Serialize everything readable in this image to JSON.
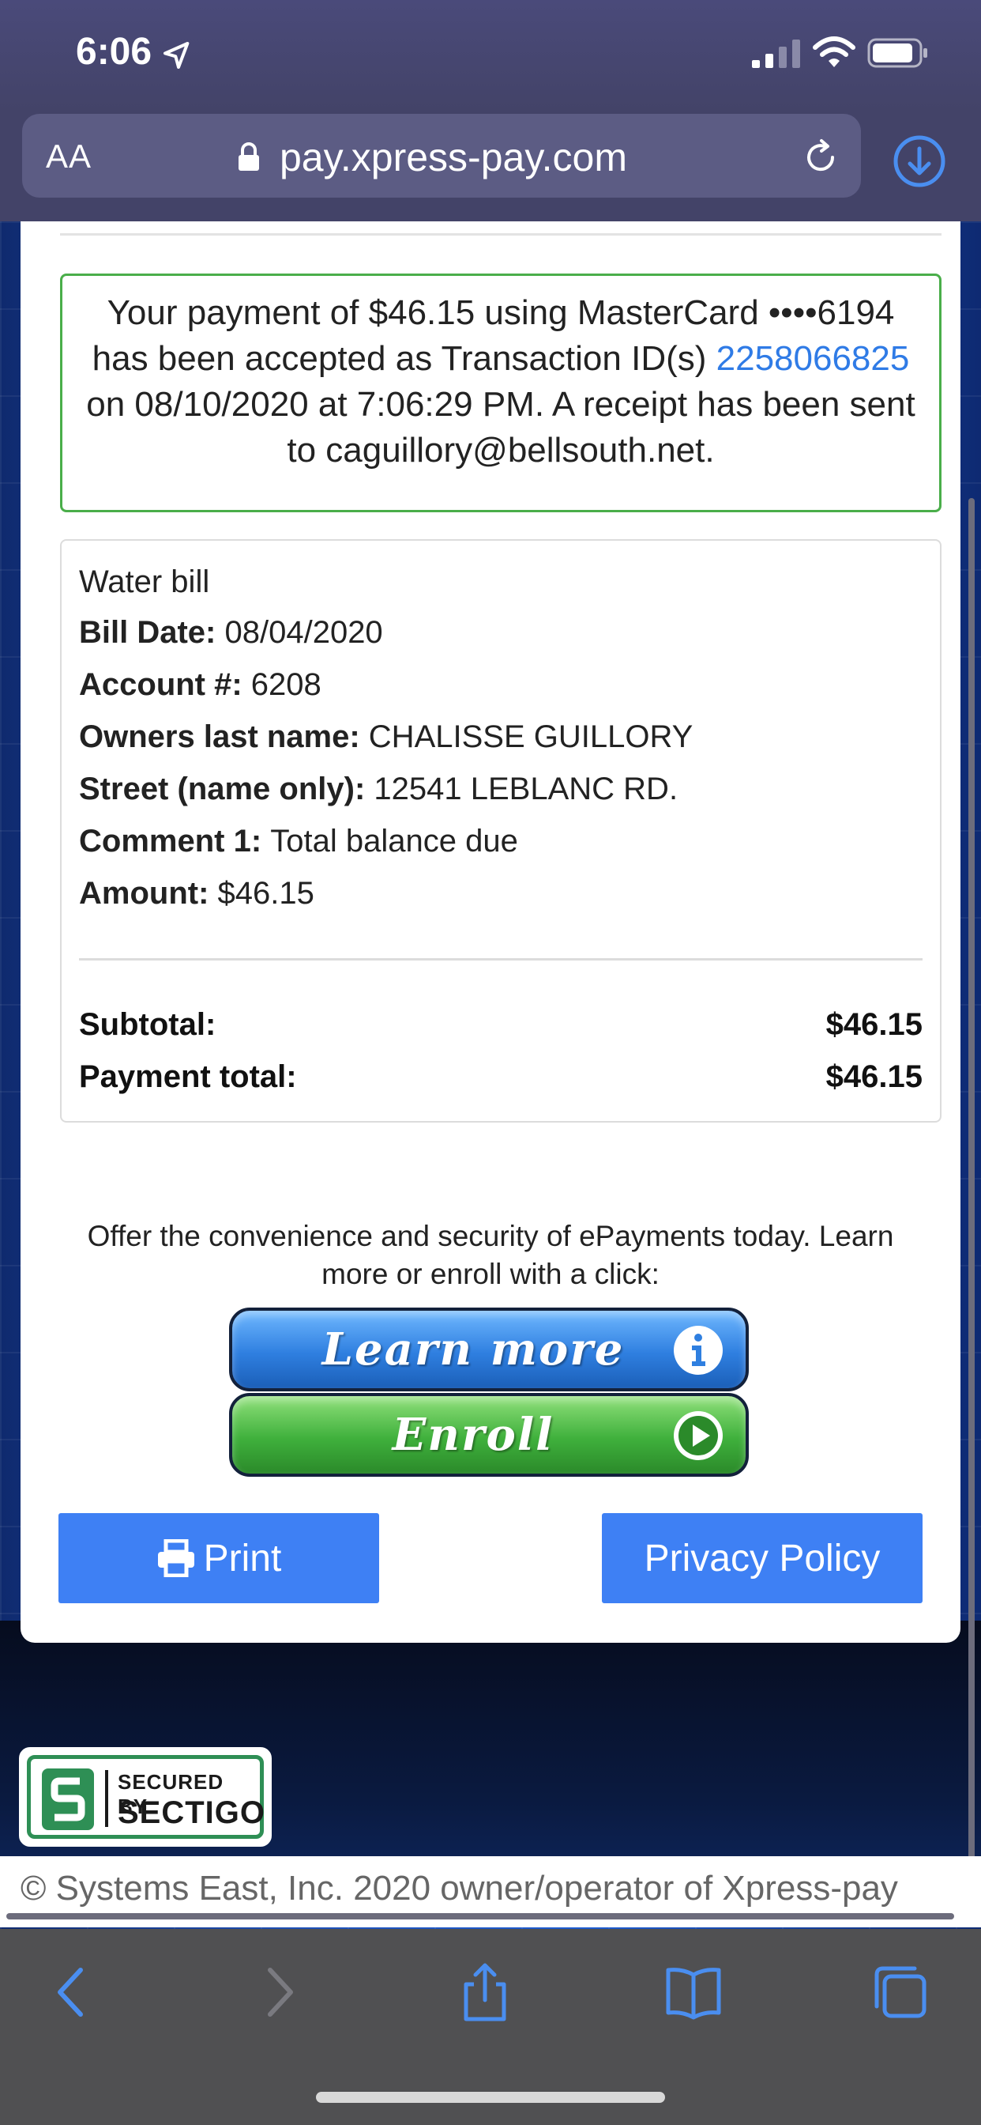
{
  "status_bar": {
    "time": "6:06"
  },
  "browser": {
    "text_size_label": "AA",
    "url": "pay.xpress-pay.com"
  },
  "confirmation": {
    "text_before": "Your payment of $46.15 using MasterCard ••••6194 has been accepted as Transaction ID(s) ",
    "transaction_id": "2258066825",
    "text_after": " on 08/10/2020 at 7:06:29 PM. A receipt has been sent to caguillory@bellsouth.net."
  },
  "bill": {
    "title": "Water bill",
    "fields": [
      {
        "label": "Bill Date:",
        "value": "08/04/2020"
      },
      {
        "label": "Account #:",
        "value": "6208"
      },
      {
        "label": "Owners last name:",
        "value": "CHALISSE GUILLORY"
      },
      {
        "label": "Street (name only):",
        "value": "12541 LEBLANC RD."
      },
      {
        "label": "Comment 1:",
        "value": "Total balance due"
      },
      {
        "label": "Amount:",
        "value": "$46.15"
      }
    ],
    "subtotal_label": "Subtotal:",
    "subtotal_value": "$46.15",
    "payment_total_label": "Payment total:",
    "payment_total_value": "$46.15"
  },
  "offer": {
    "text": "Offer the convenience and security of ePayments today. Learn more or enroll with a click:",
    "learn_more_label": "Learn more",
    "enroll_label": "Enroll"
  },
  "actions": {
    "print_label": "Print",
    "privacy_label": "Privacy Policy"
  },
  "seal": {
    "line1": "SECURED BY",
    "line2": "SECTIGO"
  },
  "footer": {
    "text": "© Systems East, Inc. 2020 owner/operator of Xpress-pay"
  },
  "colors": {
    "link": "#2f7be6",
    "primary_button": "#3e80f4",
    "success_border": "#4aae4a",
    "seal_green": "#2e8f55"
  }
}
